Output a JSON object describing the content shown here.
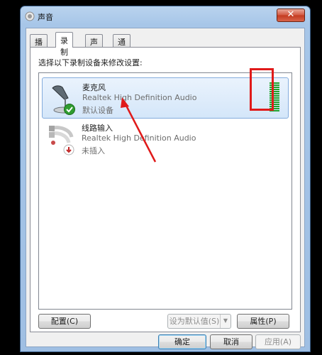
{
  "window": {
    "title": "声音",
    "close_label": "✕"
  },
  "tabs": [
    {
      "label": "播放",
      "active": false
    },
    {
      "label": "录制",
      "active": true
    },
    {
      "label": "声音",
      "active": false
    },
    {
      "label": "通信",
      "active": false
    }
  ],
  "panel": {
    "instruction": "选择以下录制设备来修改设置:"
  },
  "devices": [
    {
      "name": "麦克风",
      "description": "Realtek High Definition Audio",
      "status": "默认设备",
      "icon": "microphone-icon",
      "badge": "default-check-icon",
      "selected": true,
      "level_fraction": 1.0
    },
    {
      "name": "线路输入",
      "description": "Realtek High Definition Audio",
      "status": "未插入",
      "icon": "line-in-cable-icon",
      "badge": "unplugged-icon",
      "selected": false
    }
  ],
  "buttons": {
    "configure": "配置(C)",
    "set_default": "设为默认值(S)",
    "properties": "属性(P)",
    "ok": "确定",
    "cancel": "取消",
    "apply": "应用(A)"
  },
  "colors": {
    "accent": "#e01a1a",
    "meter": "#1fa32d",
    "selection": "#d4e6f9"
  }
}
